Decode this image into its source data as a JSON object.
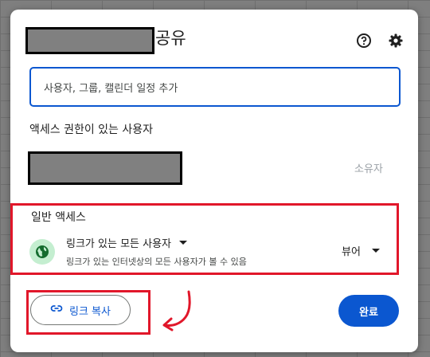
{
  "dialog": {
    "title": "공유",
    "help_icon": "help-circle-icon",
    "settings_icon": "gear-icon"
  },
  "search": {
    "placeholder": "사용자, 그룹, 캘린더 일정 추가"
  },
  "people": {
    "section_label": "액세스 권한이 있는 사용자",
    "owner_role": "소유자"
  },
  "general_access": {
    "section_label": "일반 액세스",
    "access_option": "링크가 있는 모든 사용자",
    "access_description": "링크가 있는 인터넷상의 모든 사용자가 볼 수 있음",
    "role": "뷰어",
    "icon": "globe-icon"
  },
  "footer": {
    "copy_link_label": "링크 복사",
    "copy_link_icon": "link-icon",
    "done_label": "완료"
  },
  "colors": {
    "accent": "#0b57d0",
    "highlight": "#e1172a",
    "globe_bg": "#c4eed0"
  }
}
